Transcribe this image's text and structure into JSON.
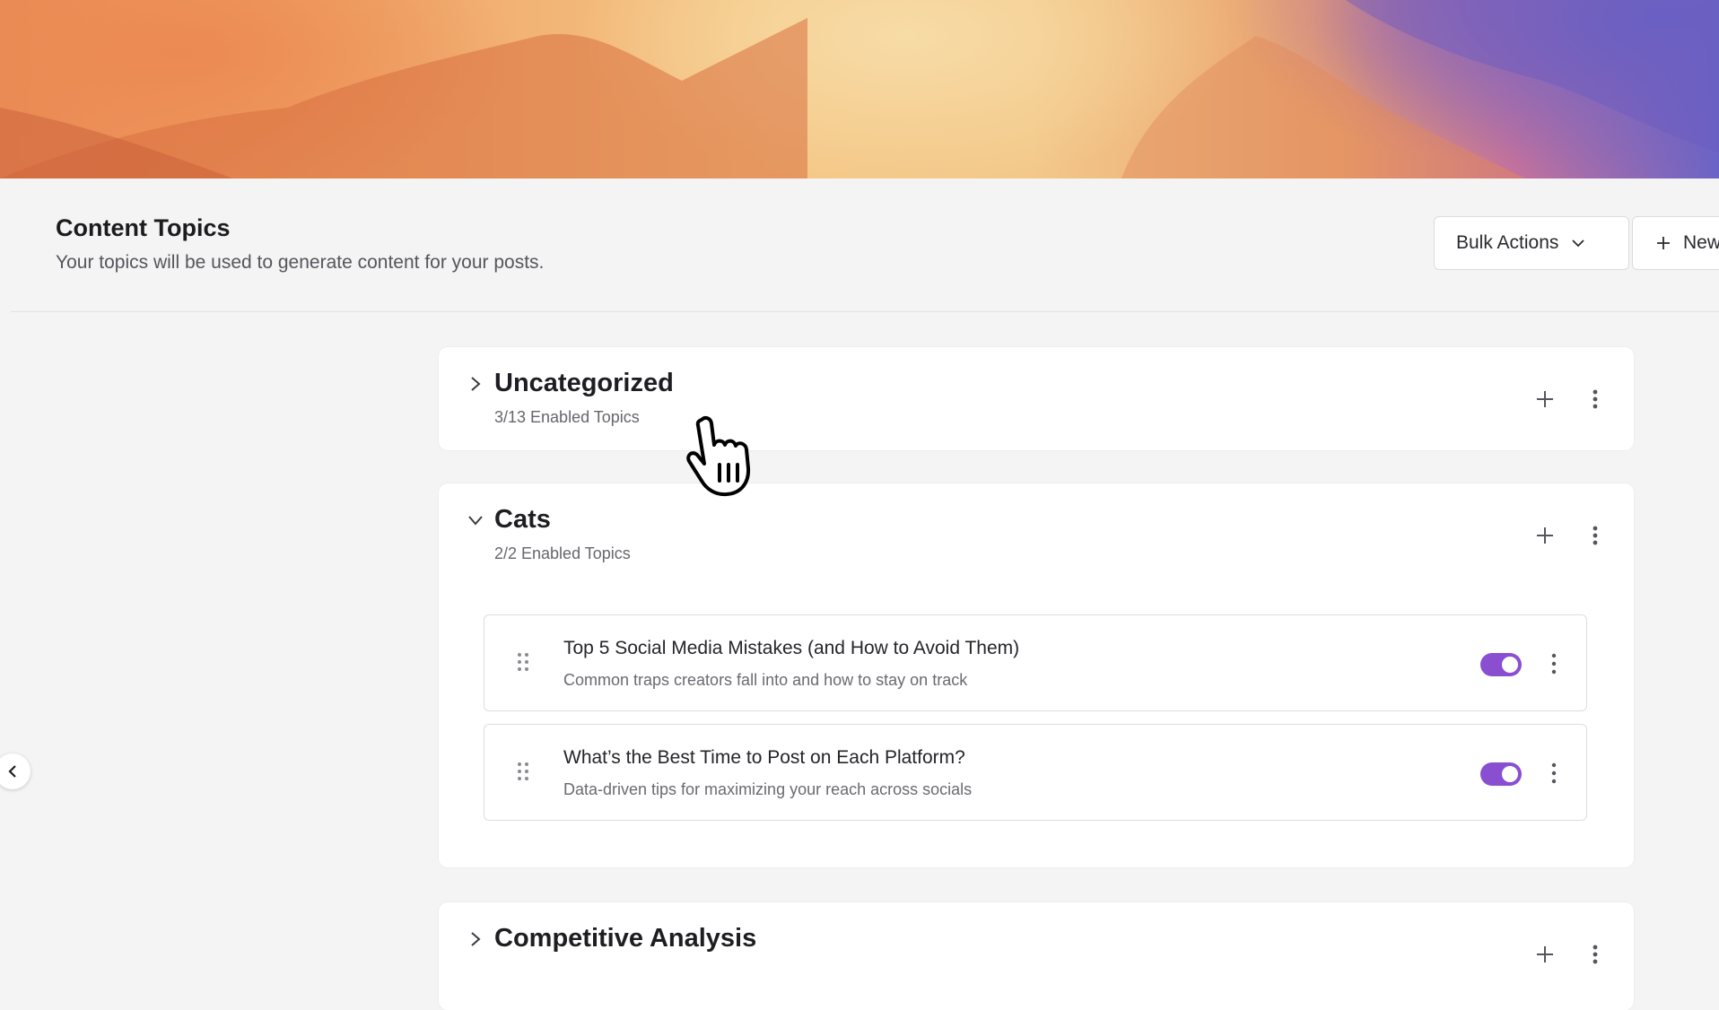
{
  "header": {
    "title": "Content Topics",
    "subtitle": "Your topics will be used to generate content for your posts.",
    "bulk_actions_label": "Bulk Actions",
    "new_label": "New"
  },
  "categories": [
    {
      "name": "Uncategorized",
      "count": "3/13 Enabled Topics",
      "expanded": false
    },
    {
      "name": "Cats",
      "count": "2/2 Enabled Topics",
      "expanded": true,
      "topics": [
        {
          "title": "Top 5 Social Media Mistakes (and How to Avoid Them)",
          "description": "Common traps creators fall into and how to stay on track",
          "enabled": true
        },
        {
          "title": "What’s the Best Time to Post on Each Platform?",
          "description": "Data-driven tips for maximizing your reach across socials",
          "enabled": true
        }
      ]
    },
    {
      "name": "Competitive Analysis",
      "expanded": false
    }
  ],
  "colors": {
    "accent": "#8a4fd0",
    "background": "#f4f4f5",
    "card": "#ffffff"
  },
  "icons": [
    "chevron-right-icon",
    "chevron-down-icon",
    "plus-icon",
    "kebab-icon",
    "drag-handle-icon",
    "chevron-left-icon",
    "hand-cursor-icon"
  ]
}
